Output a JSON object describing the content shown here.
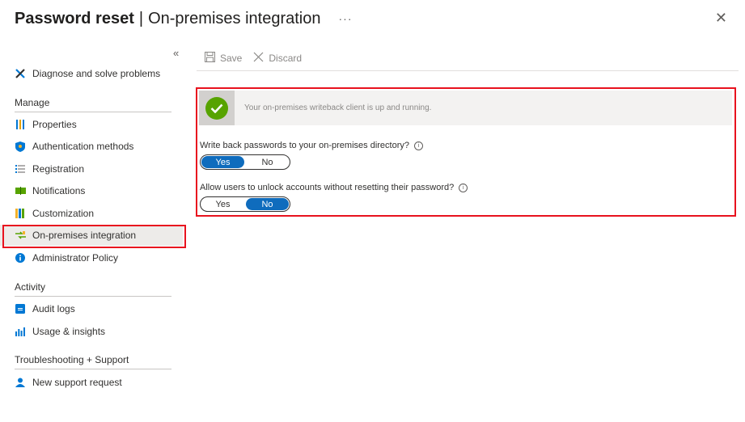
{
  "header": {
    "title": "Password reset",
    "separator": "|",
    "subtitle": "On-premises integration",
    "more": "···",
    "close": "✕"
  },
  "sidebar": {
    "collapse": "«",
    "diagnose": "Diagnose and solve problems",
    "manage_label": "Manage",
    "activity_label": "Activity",
    "troubleshooting_label": "Troubleshooting + Support",
    "items": [
      {
        "label": "Properties",
        "icon": "properties-icon"
      },
      {
        "label": "Authentication methods",
        "icon": "shield-icon"
      },
      {
        "label": "Registration",
        "icon": "registration-icon"
      },
      {
        "label": "Notifications",
        "icon": "notifications-icon"
      },
      {
        "label": "Customization",
        "icon": "customization-icon"
      },
      {
        "label": "On-premises integration",
        "icon": "on-premises-icon"
      },
      {
        "label": "Administrator Policy",
        "icon": "info-icon"
      }
    ],
    "activity_items": [
      {
        "label": "Audit logs",
        "icon": "audit-log-icon"
      },
      {
        "label": "Usage & insights",
        "icon": "usage-chart-icon"
      }
    ],
    "support_items": [
      {
        "label": "New support request",
        "icon": "support-person-icon"
      }
    ]
  },
  "toolbar": {
    "save": "Save",
    "discard": "Discard"
  },
  "main": {
    "status_text": "Your on-premises writeback client is up and running.",
    "q1": "Write back passwords to your on-premises directory?",
    "q1_value": "Yes",
    "q2": "Allow users to unlock accounts without resetting their password?",
    "q2_value": "No",
    "yes": "Yes",
    "no": "No"
  },
  "colors": {
    "accent": "#0f6cbd",
    "highlight": "#e8121e",
    "success": "#57a300"
  }
}
